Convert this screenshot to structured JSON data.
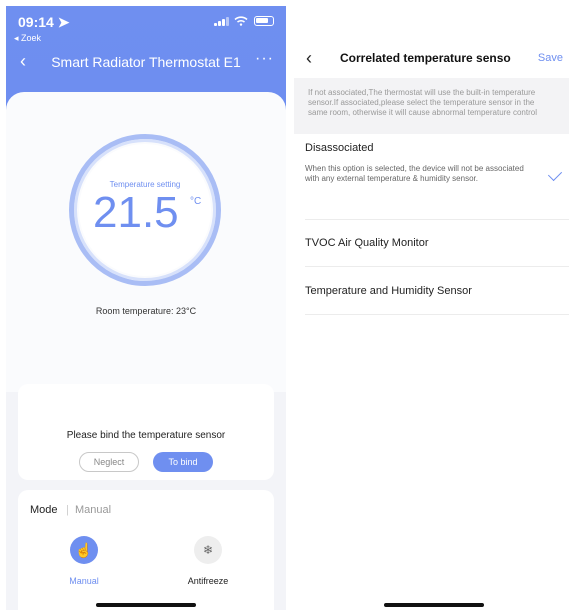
{
  "left": {
    "status": {
      "time": "09:14 ➤",
      "back": "◂ Zoek"
    },
    "nav": {
      "title": "Smart Radiator Thermostat E1",
      "back_icon": "‹",
      "more_icon": "···"
    },
    "thermostat": {
      "setting_label": "Temperature setting",
      "setting_value": "21.5",
      "unit": "°C",
      "room_temperature": "Room temperature: 23°C"
    },
    "bind_card": {
      "message": "Please bind the temperature sensor",
      "neglect_label": "Neglect",
      "bind_label": "To bind"
    },
    "mode_card": {
      "label": "Mode",
      "separator": "|",
      "value": "Manual",
      "options": [
        {
          "label": "Manual",
          "icon": "hand-icon",
          "glyph": "☝"
        },
        {
          "label": "Antifreeze",
          "icon": "snowflake-icon",
          "glyph": "❄"
        }
      ]
    }
  },
  "right": {
    "nav": {
      "back_icon": "‹",
      "title": "Correlated temperature senso",
      "save_label": "Save"
    },
    "info": "If not associated,The thermostat will use the built-in temperature sensor.If associated,please select the temperature sensor in the same room, otherwise it will cause abnormal temperature control",
    "items": [
      {
        "title": "Disassociated",
        "desc": "When this option is selected, the device will not be associated with any external temperature & humidity sensor.",
        "selected": true
      },
      {
        "title": "TVOC Air Quality Monitor"
      },
      {
        "title": "Temperature and Humidity Sensor"
      }
    ]
  },
  "colors": {
    "accent": "#6f8ff0",
    "ring": "#a9bdf5",
    "background": "#f3f4f8"
  }
}
